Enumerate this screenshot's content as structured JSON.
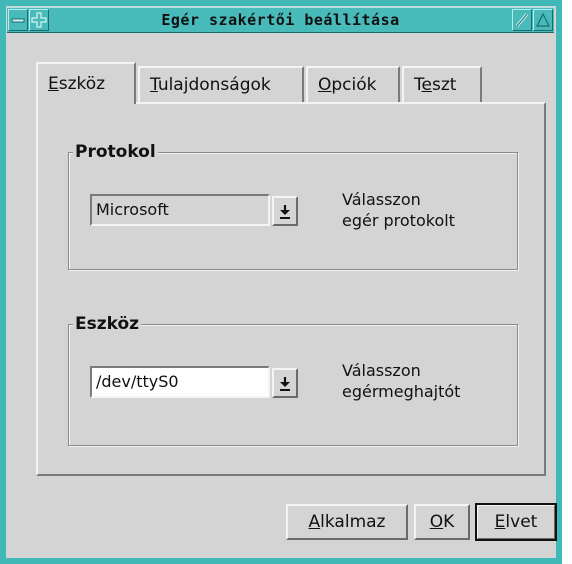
{
  "window": {
    "title": "Egér szakértői beállítása"
  },
  "tabs": [
    {
      "mn": "E",
      "rest": "szköz"
    },
    {
      "mn": "T",
      "rest": "ulajdonságok"
    },
    {
      "mn": "O",
      "rest": "pciók"
    },
    {
      "pre": "T",
      "mn": "e",
      "rest": "szt"
    }
  ],
  "protocol_group": {
    "label": "Protokol",
    "value": "Microsoft",
    "hint_line1": "Válasszon",
    "hint_line2": "egér protokolt"
  },
  "device_group": {
    "label": "Eszköz",
    "value": "/dev/ttyS0",
    "hint_line1": "Válasszon",
    "hint_line2": "egérmeghajtót"
  },
  "buttons": {
    "apply": {
      "mn": "A",
      "rest": "lkalmaz"
    },
    "ok": {
      "mn": "O",
      "rest": "K"
    },
    "cancel": {
      "mn": "E",
      "rest": "lvet"
    }
  },
  "colors": {
    "frame": "#40b8b8",
    "face": "#d4d4d4"
  },
  "icons": [
    "window-menu-icon",
    "window-plus-icon",
    "maximize-icon",
    "minimize-icon",
    "dropdown-arrow-icon"
  ]
}
